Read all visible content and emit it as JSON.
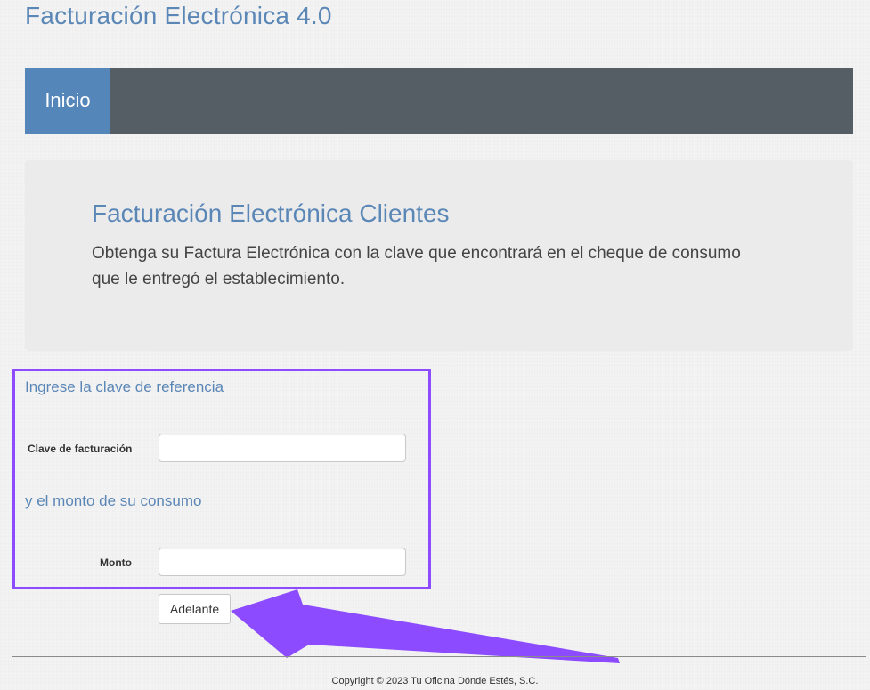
{
  "app": {
    "title": "Facturación Electrónica 4.0"
  },
  "nav": {
    "items": [
      {
        "label": "Inicio",
        "active": true
      }
    ]
  },
  "jumbotron": {
    "title": "Facturación Electrónica Clientes",
    "lead": "Obtenga su Factura Electrónica con la clave que encontrará en el cheque de consumo que le entregó el establecimiento."
  },
  "form": {
    "reference_heading": "Ingrese la clave de referencia",
    "clave_label": "Clave de facturación",
    "clave_value": "",
    "amount_heading": "y el monto de su consumo",
    "monto_label": "Monto",
    "monto_value": "",
    "submit_label": "Adelante"
  },
  "footer": {
    "copyright": "Copyright © 2023 Tu Oficina Dónde Estés, S.C."
  },
  "colors": {
    "accent": "#5b87b7",
    "navbar": "#545e64",
    "nav_active": "#5586b9",
    "annotation": "#8c4bff"
  },
  "annotations": {
    "highlight_box": "purple-rectangle",
    "pointer": "purple-arrow-pointing-to-submit"
  }
}
